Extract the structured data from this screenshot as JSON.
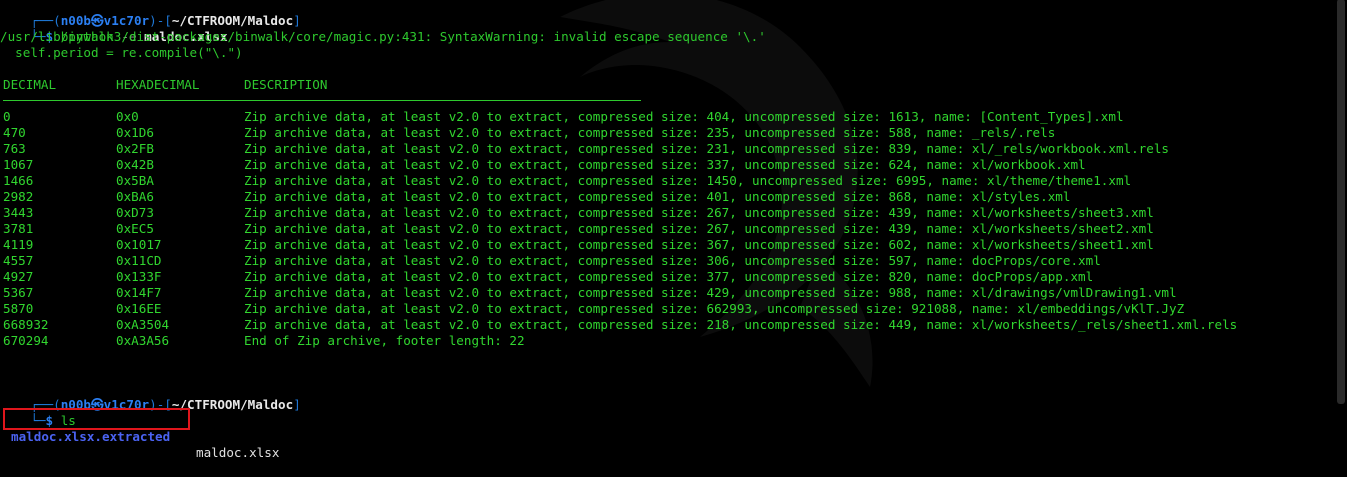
{
  "prompt1": {
    "user": "n00b㉿v1c70r",
    "path": "~/CTFROOM/Maldoc",
    "command": "binwalk",
    "flag": "-e",
    "file": "maldoc.xlsx"
  },
  "warning": {
    "line1": "/usr/lib/python3/dist-packages/binwalk/core/magic.py:431: SyntaxWarning: invalid escape sequence '\\.'",
    "line2": "  self.period = re.compile(\"\\.\")"
  },
  "table": {
    "headers": [
      "DECIMAL",
      "HEXADECIMAL",
      "DESCRIPTION"
    ],
    "rows": [
      [
        "0",
        "0x0",
        "Zip archive data, at least v2.0 to extract, compressed size: 404, uncompressed size: 1613, name: [Content_Types].xml"
      ],
      [
        "470",
        "0x1D6",
        "Zip archive data, at least v2.0 to extract, compressed size: 235, uncompressed size: 588, name: _rels/.rels"
      ],
      [
        "763",
        "0x2FB",
        "Zip archive data, at least v2.0 to extract, compressed size: 231, uncompressed size: 839, name: xl/_rels/workbook.xml.rels"
      ],
      [
        "1067",
        "0x42B",
        "Zip archive data, at least v2.0 to extract, compressed size: 337, uncompressed size: 624, name: xl/workbook.xml"
      ],
      [
        "1466",
        "0x5BA",
        "Zip archive data, at least v2.0 to extract, compressed size: 1450, uncompressed size: 6995, name: xl/theme/theme1.xml"
      ],
      [
        "2982",
        "0xBA6",
        "Zip archive data, at least v2.0 to extract, compressed size: 401, uncompressed size: 868, name: xl/styles.xml"
      ],
      [
        "3443",
        "0xD73",
        "Zip archive data, at least v2.0 to extract, compressed size: 267, uncompressed size: 439, name: xl/worksheets/sheet3.xml"
      ],
      [
        "3781",
        "0xEC5",
        "Zip archive data, at least v2.0 to extract, compressed size: 267, uncompressed size: 439, name: xl/worksheets/sheet2.xml"
      ],
      [
        "4119",
        "0x1017",
        "Zip archive data, at least v2.0 to extract, compressed size: 367, uncompressed size: 602, name: xl/worksheets/sheet1.xml"
      ],
      [
        "4557",
        "0x11CD",
        "Zip archive data, at least v2.0 to extract, compressed size: 306, uncompressed size: 597, name: docProps/core.xml"
      ],
      [
        "4927",
        "0x133F",
        "Zip archive data, at least v2.0 to extract, compressed size: 377, uncompressed size: 820, name: docProps/app.xml"
      ],
      [
        "5367",
        "0x14F7",
        "Zip archive data, at least v2.0 to extract, compressed size: 429, uncompressed size: 988, name: xl/drawings/vmlDrawing1.vml"
      ],
      [
        "5870",
        "0x16EE",
        "Zip archive data, at least v2.0 to extract, compressed size: 662993, uncompressed size: 921088, name: xl/embeddings/vKlT.JyZ"
      ],
      [
        "668932",
        "0xA3504",
        "Zip archive data, at least v2.0 to extract, compressed size: 218, uncompressed size: 449, name: xl/worksheets/_rels/sheet1.xml.rels"
      ],
      [
        "670294",
        "0xA3A56",
        "End of Zip archive, footer length: 22"
      ]
    ]
  },
  "prompt2": {
    "user": "n00b㉿v1c70r",
    "path": "~/CTFROOM/Maldoc",
    "command": "ls"
  },
  "ls_output": {
    "dir": "maldoc.xlsx.extracted",
    "file": "maldoc.xlsx"
  },
  "colors": {
    "background": "#000000",
    "output_green": "#2ec92e",
    "prompt_blue": "#2b7ff2",
    "dir_blue": "#4b63f2",
    "highlight_red": "#e0161c"
  }
}
